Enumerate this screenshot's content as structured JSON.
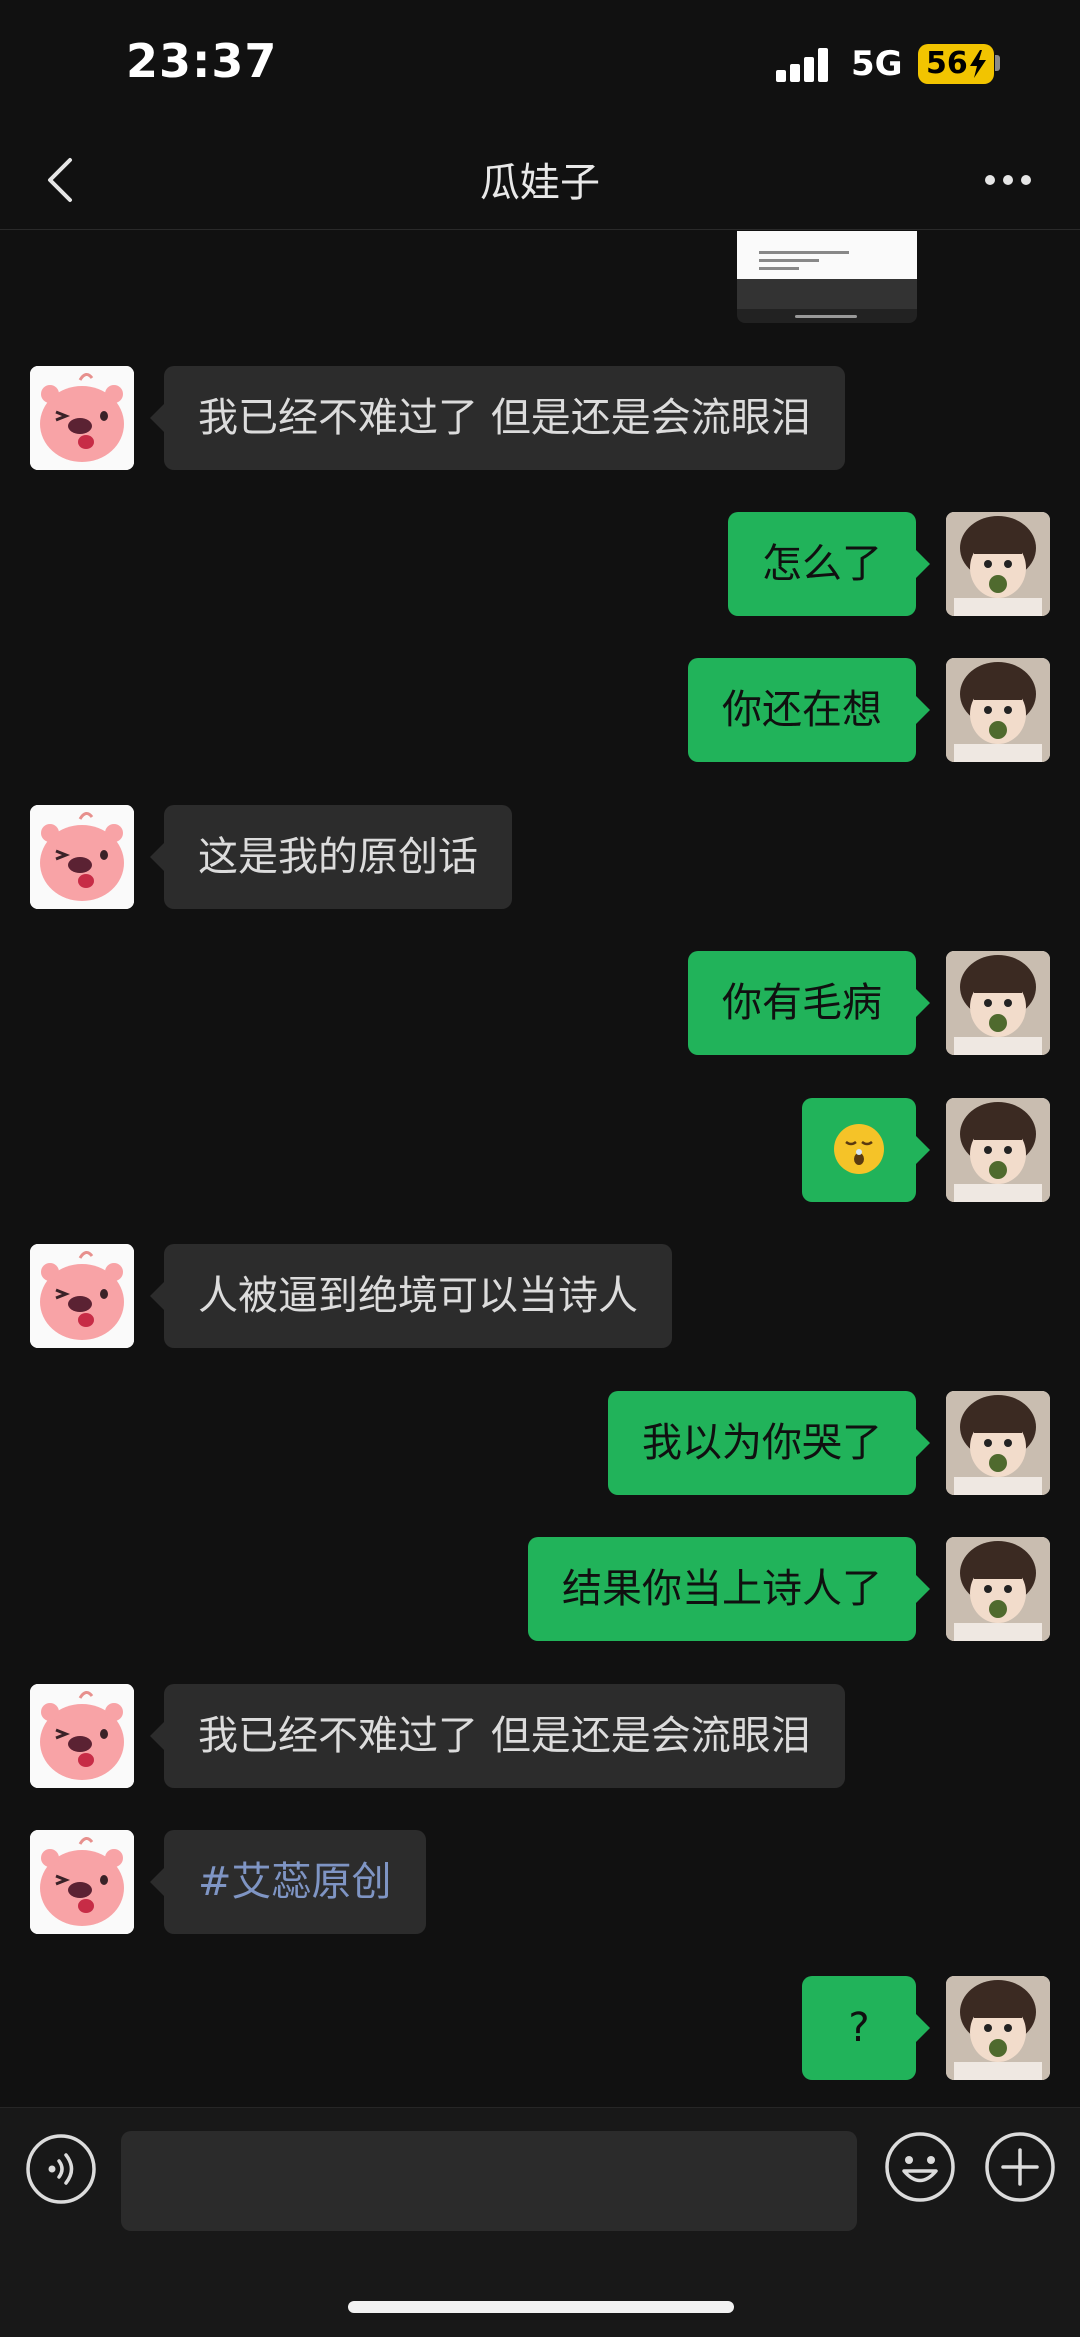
{
  "status": {
    "time": "23:37",
    "network": "5G",
    "battery": "56"
  },
  "nav": {
    "title": "瓜娃子"
  },
  "messages": [
    {
      "side": "left",
      "text": "我已经不难过了 但是还是会流眼泪"
    },
    {
      "side": "right",
      "text": "怎么了"
    },
    {
      "side": "right",
      "text": "你还在想"
    },
    {
      "side": "left",
      "text": "这是我的原创话"
    },
    {
      "side": "right",
      "text": "你有毛病"
    },
    {
      "side": "right",
      "text": "",
      "emoji": "sleepy-face-emoji"
    },
    {
      "side": "left",
      "text": "人被逼到绝境可以当诗人"
    },
    {
      "side": "right",
      "text": "我以为你哭了"
    },
    {
      "side": "right",
      "text": "结果你当上诗人了"
    },
    {
      "side": "left",
      "text": "我已经不难过了 但是还是会流眼泪"
    },
    {
      "side": "left",
      "text": "#艾蕊原创",
      "link": true
    },
    {
      "side": "right",
      "text": "?"
    }
  ],
  "input": {
    "value": "",
    "placeholder": ""
  },
  "colors": {
    "background": "#111111",
    "bubble_self": "#21b35a",
    "bubble_other": "#2c2c2c",
    "link_text": "#7f95c4",
    "battery": "#f2c400"
  },
  "icons": {
    "back": "chevron-left-icon",
    "more": "ellipsis-icon",
    "voice": "voice-icon",
    "emoji": "smiley-icon",
    "plus": "plus-icon"
  }
}
